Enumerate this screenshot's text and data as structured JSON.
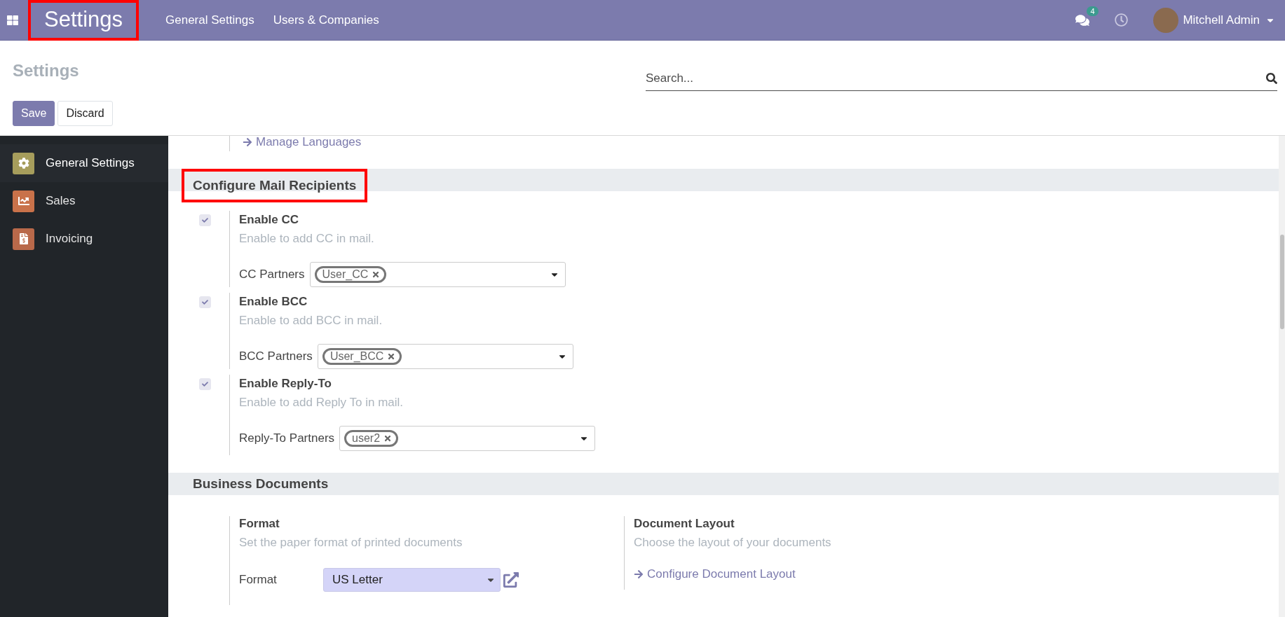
{
  "navbar": {
    "brand": {
      "text": "Settings",
      "highlighted": true
    },
    "menu": [
      "General Settings",
      "Users & Companies"
    ],
    "messages_count": "4",
    "user": "Mitchell Admin"
  },
  "control_panel": {
    "title": "Settings",
    "search": {
      "placeholder": "Search..."
    },
    "buttons": [
      {
        "label": "Save",
        "kind": "primary"
      },
      {
        "label": "Discard",
        "kind": "secondary"
      }
    ]
  },
  "sidebar": {
    "items": [
      {
        "label": "General Settings",
        "selected": true,
        "kind": "settings"
      },
      {
        "label": "Sales",
        "selected": false,
        "kind": "sales"
      },
      {
        "label": "Invoicing",
        "selected": false,
        "kind": "invoicing"
      }
    ]
  },
  "content": {
    "top_link": "Manage Languages",
    "sections": [
      {
        "title": "Configure Mail Recipients",
        "highlighted": true,
        "kind": "stacked",
        "settings": [
          {
            "title": "Enable CC",
            "description": "Enable to add CC in mail.",
            "checked": true,
            "field": {
              "kind": "tags",
              "label": "CC Partners",
              "tags": [
                "User_CC"
              ]
            }
          },
          {
            "title": "Enable BCC",
            "description": "Enable to add BCC in mail.",
            "checked": true,
            "field": {
              "kind": "tags",
              "label": "BCC Partners",
              "tags": [
                "User_BCC"
              ]
            }
          },
          {
            "title": "Enable Reply-To",
            "description": "Enable to add Reply To in mail.",
            "checked": true,
            "field": {
              "kind": "tags",
              "label": "Reply-To Partners",
              "tags": [
                "user2"
              ]
            }
          }
        ]
      },
      {
        "title": "Business Documents",
        "highlighted": false,
        "kind": "columns",
        "settings": [
          {
            "title": "Format",
            "description": "Set the paper format of printed documents",
            "field": {
              "kind": "select",
              "label": "Format",
              "value": "US Letter"
            }
          },
          {
            "title": "Document Layout",
            "description": "Choose the layout of your documents",
            "field": {
              "kind": "link",
              "label": "Configure Document Layout"
            }
          }
        ]
      }
    ]
  }
}
